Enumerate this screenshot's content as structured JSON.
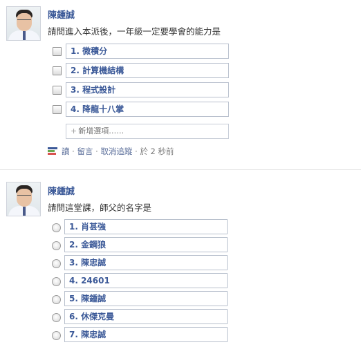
{
  "posts": [
    {
      "author": "陳鍾誠",
      "question": "請問進入本派後，一年級一定要學會的能力是",
      "input_type": "checkbox",
      "options": [
        "1. 微積分",
        "2. 計算機結構",
        "3. 程式設計",
        "4. 降龍十八掌"
      ],
      "add_option": {
        "icon": "plus-icon",
        "label": "新增選項……"
      },
      "footer": {
        "icon": "poll-icon",
        "vote": "讀",
        "comment": "留言",
        "unfollow": "取消追蹤",
        "time": "於 2 秒前",
        "sep": "·"
      }
    },
    {
      "author": "陳鍾誠",
      "question": "請問這堂課，師父的名字是",
      "input_type": "radio",
      "options": [
        "1. 肖甚強",
        "2. 金鋼狼",
        "3. 陳忠誠",
        "4. 24601",
        "5. 陳鍾誠",
        "6. 休傑克曼",
        "7. 陳忠誠"
      ]
    }
  ],
  "colors": {
    "link": "#3b5998",
    "muted": "#777777",
    "box_border": "#b7bfcc"
  }
}
